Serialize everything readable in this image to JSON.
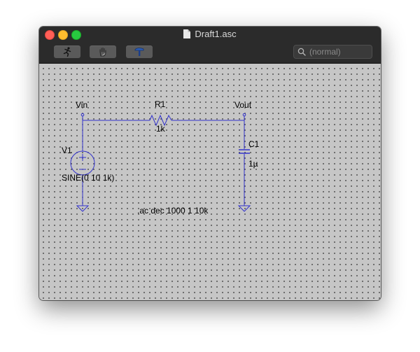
{
  "window": {
    "title": "Draft1.asc"
  },
  "toolbar": {
    "buttons": [
      {
        "name": "run",
        "icon": "running-man-icon"
      },
      {
        "name": "halt",
        "icon": "hand-icon"
      },
      {
        "name": "edit",
        "icon": "hammer-icon"
      }
    ],
    "search_placeholder": "(normal)"
  },
  "schematic": {
    "nets": {
      "vin": "Vin",
      "vout": "Vout"
    },
    "resistor": {
      "ref": "R1",
      "value": "1k"
    },
    "capacitor": {
      "ref": "C1",
      "value": "1µ"
    },
    "source": {
      "ref": "V1",
      "value": "SINE(0 10 1k)"
    },
    "directive": ".ac dec 1000 1 10k"
  },
  "colors": {
    "wire": "#3333cc",
    "titlebar": "#2b2b2b",
    "canvas": "#c6c6c6"
  }
}
